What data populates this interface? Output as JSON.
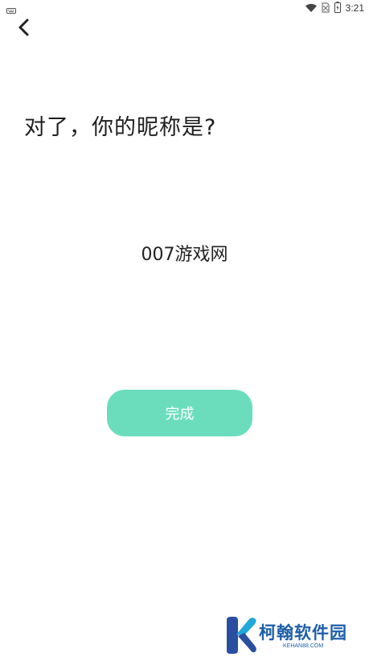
{
  "status_bar": {
    "time": "3:21",
    "icons": [
      "keyboard-icon",
      "wifi-icon",
      "no-sim-icon",
      "battery-icon"
    ]
  },
  "header": {
    "back_icon": "back-arrow-icon"
  },
  "main": {
    "question": "对了，你的昵称是?",
    "nickname_value": "007游戏网",
    "done_label": "完成"
  },
  "watermark": {
    "title": "柯翰软件园",
    "subtitle": "KEHAN88.COM"
  },
  "colors": {
    "button_bg": "#6bddbd",
    "button_text": "#ffffff",
    "watermark": "#1e5ea8"
  }
}
